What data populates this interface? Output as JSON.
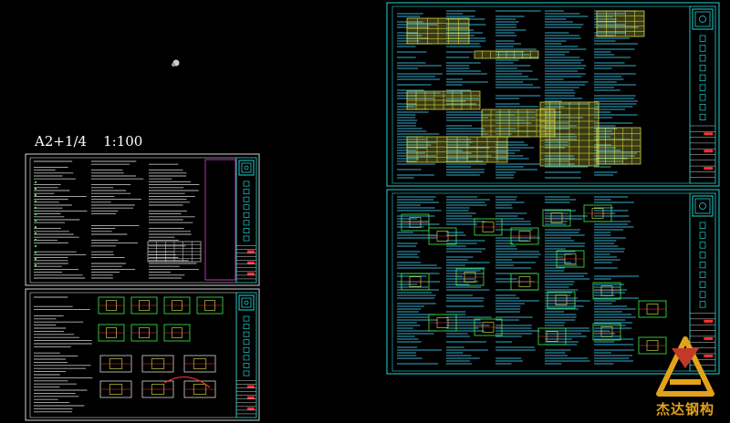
{
  "drawing": {
    "scale_label": "A2+1/4",
    "ratio_label": "1:100"
  },
  "title_block": {
    "company": "弘 华 建 筑 设 计 有 限 公 司"
  },
  "watermark": {
    "brand": "杰达钢构",
    "logo_icon": "jieda-logo-icon"
  },
  "colors": {
    "background": "#000000",
    "frame": "#22d3d3",
    "text_cyan": "#3ec9f0",
    "text_yellow": "#e8e84a",
    "text_green": "#3bf04a",
    "accent_red": "#ff3030",
    "accent_magenta": "#e040e0",
    "watermark": "#e2a21a"
  }
}
